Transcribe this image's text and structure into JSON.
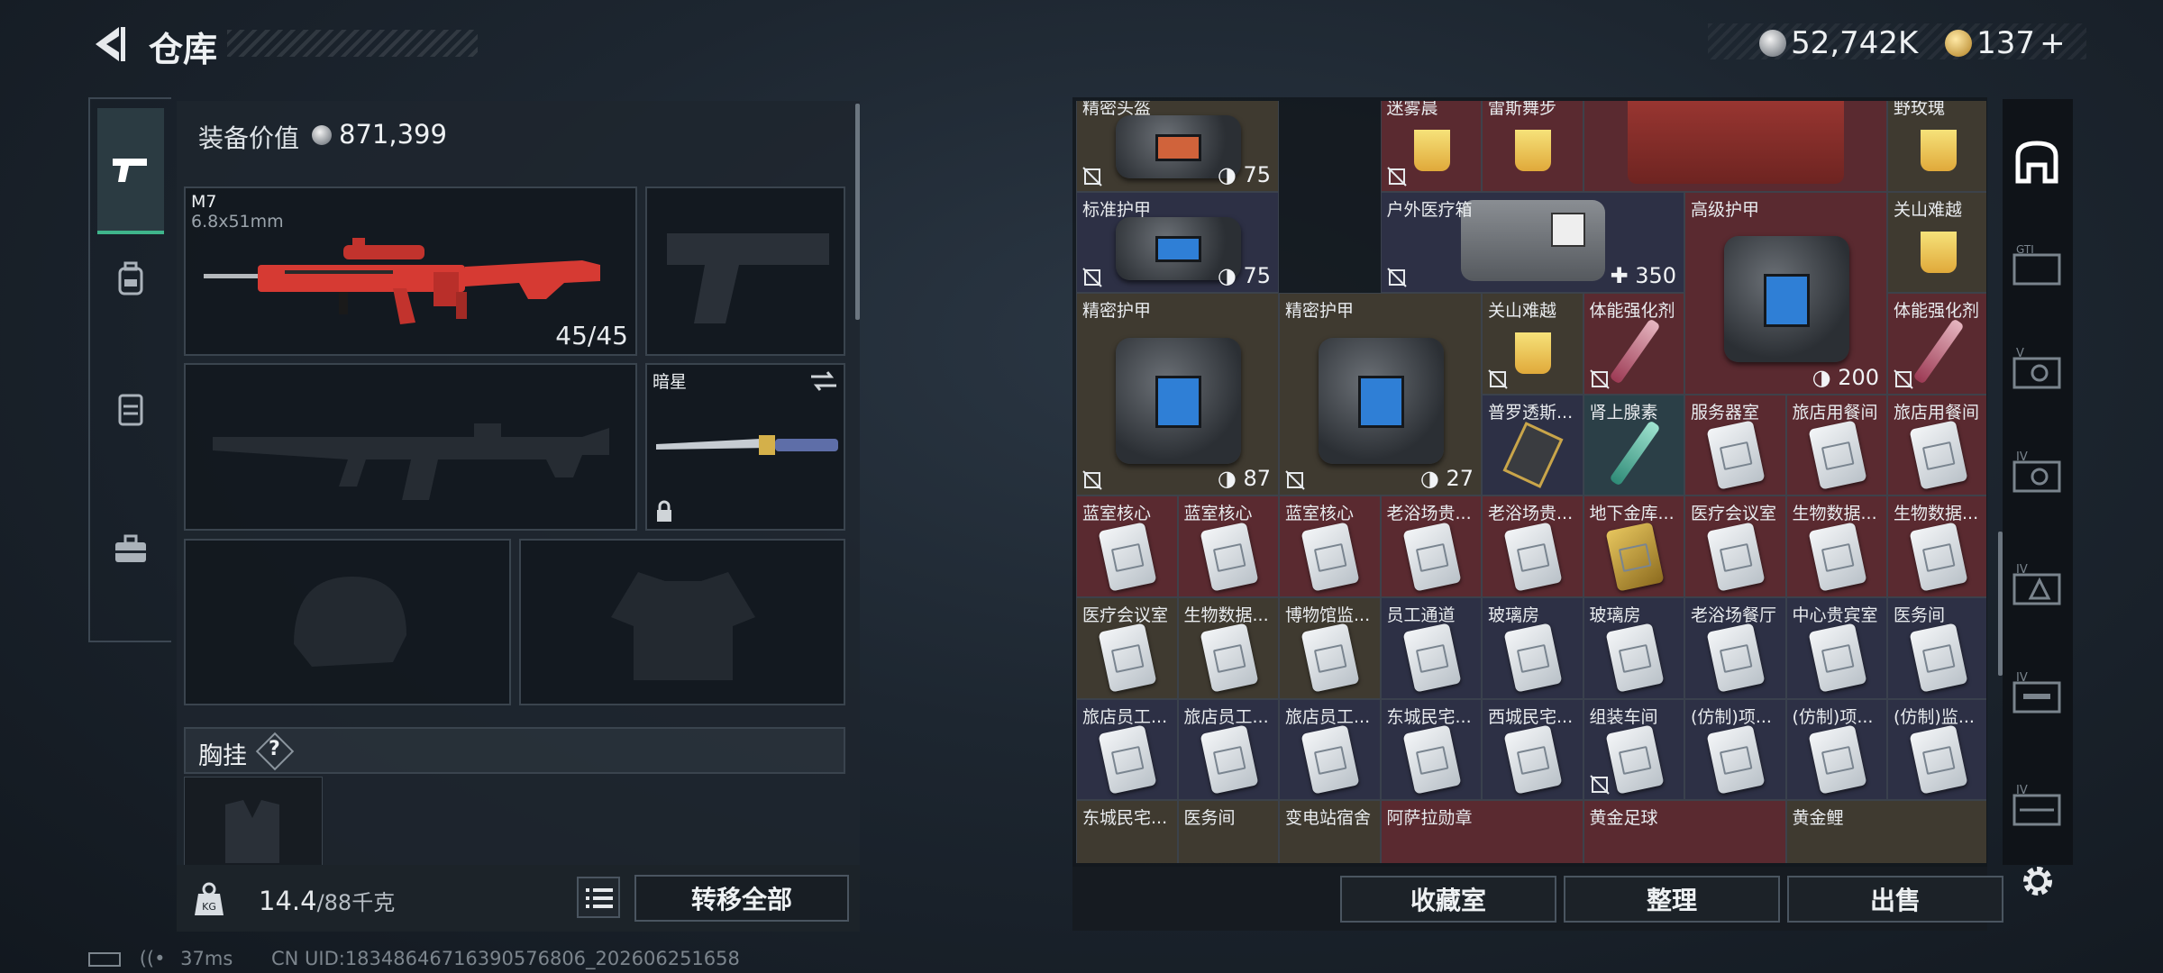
{
  "header": {
    "title": "仓库"
  },
  "currency": {
    "silver": "52,742K",
    "gold": "137",
    "gold_plus": "+"
  },
  "equipment": {
    "value_label": "装备价值",
    "value": "871,399",
    "primary": {
      "name": "M7",
      "caliber": "6.8x51mm",
      "ammo": "45/45"
    },
    "melee": {
      "name": "暗星"
    },
    "rig_label": "胸挂",
    "rig_help": "?"
  },
  "bottom_left": {
    "weight_value": "14.4",
    "weight_max": "/88千克",
    "transfer_all": "转移全部"
  },
  "bottom_right": {
    "collection": "收藏室",
    "organize": "整理",
    "sell": "出售"
  },
  "status": {
    "ping": "37ms",
    "uid": "CN UID:18348646716390576806_202606251658"
  },
  "colors": {
    "accent_green": "#3fb58b",
    "red_cell": "#5a2a30",
    "brown_cell": "#3f3a30",
    "blue_cell": "#2d3045",
    "teal_cell": "#2b3f47"
  },
  "grid_items": [
    {
      "name": "精密头盔",
      "count": "75",
      "count_icon": "shield"
    },
    {
      "name": "迷雾晨"
    },
    {
      "name": "雷斯舞步"
    },
    {
      "name": "野玫瑰"
    },
    {
      "name": "标准护甲",
      "count": "75",
      "count_icon": "shield"
    },
    {
      "name": "户外医疗箱",
      "count": "350",
      "count_icon": "plus"
    },
    {
      "name": "高级护甲",
      "count": "200",
      "count_icon": "shield"
    },
    {
      "name": "关山难越"
    },
    {
      "name": "精密护甲",
      "count": "87",
      "count_icon": "shield"
    },
    {
      "name": "精密护甲",
      "count": "27",
      "count_icon": "shield"
    },
    {
      "name": "关山难越"
    },
    {
      "name": "体能强化剂"
    },
    {
      "name": "体能强化剂"
    },
    {
      "name": "普罗透斯..."
    },
    {
      "name": "肾上腺素"
    },
    {
      "name": "服务器室"
    },
    {
      "name": "旅店用餐间"
    },
    {
      "name": "旅店用餐间"
    },
    {
      "name": "蓝室核心"
    },
    {
      "name": "蓝室核心"
    },
    {
      "name": "蓝室核心"
    },
    {
      "name": "老浴场贵..."
    },
    {
      "name": "老浴场贵..."
    },
    {
      "name": "地下金库..."
    },
    {
      "name": "医疗会议室"
    },
    {
      "name": "生物数据..."
    },
    {
      "name": "生物数据..."
    },
    {
      "name": "医疗会议室"
    },
    {
      "name": "生物数据..."
    },
    {
      "name": "博物馆监..."
    },
    {
      "name": "员工通道"
    },
    {
      "name": "玻璃房"
    },
    {
      "name": "玻璃房"
    },
    {
      "name": "老浴场餐厅"
    },
    {
      "name": "中心贵宾室"
    },
    {
      "name": "医务间"
    },
    {
      "name": "旅店员工..."
    },
    {
      "name": "旅店员工..."
    },
    {
      "name": "旅店员工..."
    },
    {
      "name": "东城民宅..."
    },
    {
      "name": "西城民宅..."
    },
    {
      "name": "组装车间"
    },
    {
      "name": "(仿制)项..."
    },
    {
      "name": "(仿制)项..."
    },
    {
      "name": "(仿制)监..."
    },
    {
      "name": "东城民宅..."
    },
    {
      "name": "医务间"
    },
    {
      "name": "变电站宿舍"
    },
    {
      "name": "阿萨拉勋章"
    },
    {
      "name": "黄金足球"
    },
    {
      "name": "黄金鲤"
    }
  ]
}
